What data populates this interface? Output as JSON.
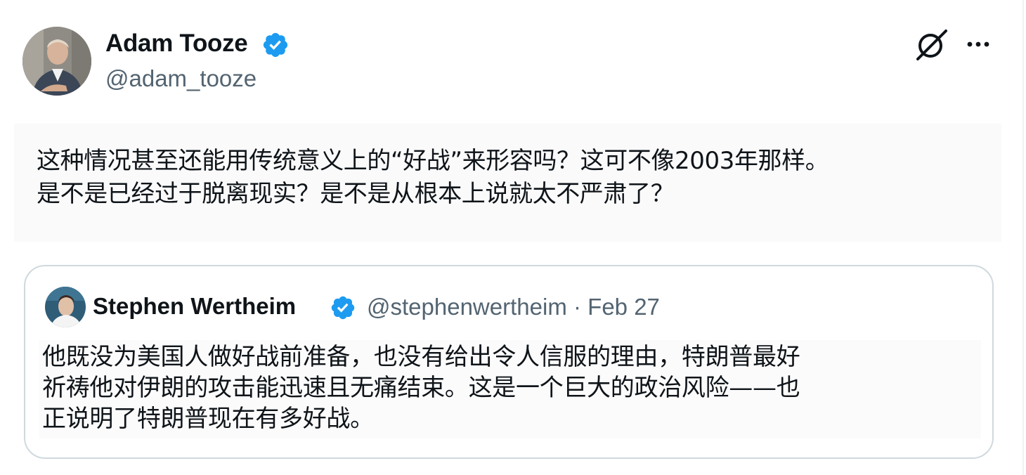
{
  "author": {
    "name": "Adam Tooze",
    "handle": "@adam_tooze",
    "verified": true
  },
  "tweet": {
    "lines": [
      "这种情况甚至还能用传统意义上的“好战”来形容吗？这可不像2003年那样。",
      "是不是已经过于脱离现实？是不是从根本上说就太不严肃了？"
    ]
  },
  "quote": {
    "author_name": "Stephen Wertheim",
    "handle": "@stephenwertheim",
    "separator": "·",
    "date": "Feb 27",
    "verified": true,
    "lines": [
      "他既没为美国人做好战前准备，也没有给出令人信服的理由，特朗普最好",
      "祈祷他对伊朗的攻击能迅速且无痛结束。这是一个巨大的政治风险——也",
      "正说明了特朗普现在有多好战。"
    ]
  },
  "icons": {
    "verified": "verified-badge-icon",
    "grok": "grok-icon",
    "more": "more-options-icon"
  },
  "colors": {
    "verified_blue": "#1d9bf0",
    "secondary_text": "#536471",
    "border": "#cfd9de"
  }
}
